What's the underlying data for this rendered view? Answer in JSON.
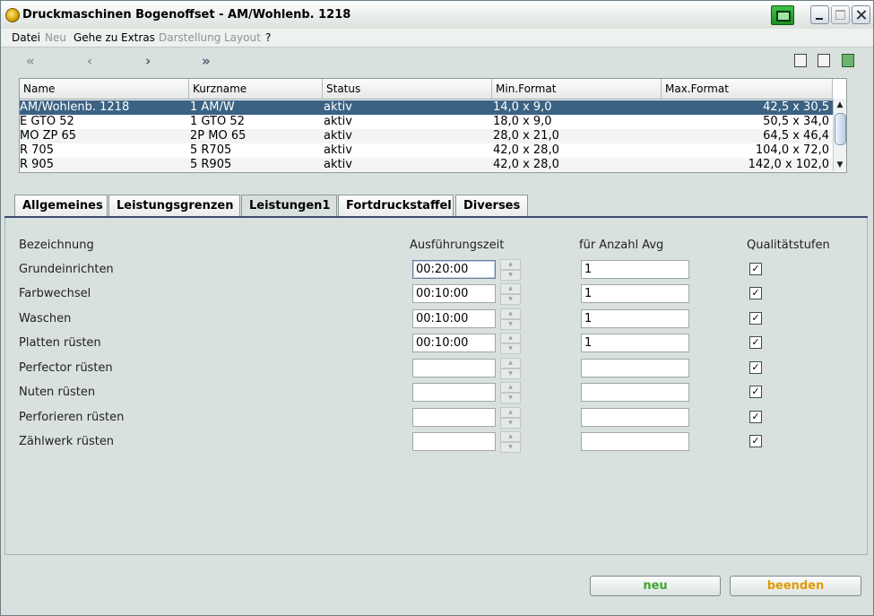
{
  "window": {
    "title": "Druckmaschinen Bogenoffset - AM/Wohlenb.  1218"
  },
  "menu": [
    "Datei",
    "Neu",
    "Gehe zu",
    "Extras",
    "Darstellung",
    "Layout",
    "?"
  ],
  "grid": {
    "columns": [
      "Name",
      "Kurzname",
      "Status",
      "Min.Format",
      "Max.Format"
    ],
    "rows": [
      {
        "name": "AM/Wohlenb.  1218",
        "kurz": "1  AM/W",
        "status": "aktiv",
        "min": "14,0 x 9,0",
        "max": "42,5 x 30,5"
      },
      {
        "name": "E  GTO 52",
        "kurz": "1  GTO  52",
        "status": "aktiv",
        "min": "18,0 x 9,0",
        "max": "50,5 x 34,0"
      },
      {
        "name": "MO ZP 65",
        "kurz": "2P MO   65",
        "status": "aktiv",
        "min": "28,0 x 21,0",
        "max": "64,5 x 46,4"
      },
      {
        "name": "R 705",
        "kurz": "5  R705",
        "status": "aktiv",
        "min": "42,0 x 28,0",
        "max": "104,0 x 72,0"
      },
      {
        "name": "R 905",
        "kurz": "5  R905",
        "status": "aktiv",
        "min": "42,0 x 28,0",
        "max": "142,0 x 102,0"
      }
    ]
  },
  "tabs": [
    "Allgemeines",
    "Leistungsgrenzen",
    "Leistungen1",
    "Fortdruckstaffel",
    "Diverses"
  ],
  "form": {
    "headers": {
      "bez": "Bezeichnung",
      "zeit": "Ausführungszeit",
      "anzahl": "für Anzahl Avg",
      "qual": "Qualitätstufen"
    },
    "rows": [
      {
        "label": "Grundeinrichten",
        "zeit": "00:20:00",
        "anzahl": "1"
      },
      {
        "label": "Farbwechsel",
        "zeit": "00:10:00",
        "anzahl": "1"
      },
      {
        "label": "Waschen",
        "zeit": "00:10:00",
        "anzahl": "1"
      },
      {
        "label": "Platten rüsten",
        "zeit": "00:10:00",
        "anzahl": "1"
      },
      {
        "label": "Perfector rüsten",
        "zeit": "",
        "anzahl": ""
      },
      {
        "label": "Nuten rüsten",
        "zeit": "",
        "anzahl": ""
      },
      {
        "label": "Perforieren rüsten",
        "zeit": "",
        "anzahl": ""
      },
      {
        "label": "Zählwerk rüsten",
        "zeit": "",
        "anzahl": ""
      }
    ],
    "check_glyph": "✓"
  },
  "buttons": {
    "neu": "neu",
    "beenden": "beenden"
  },
  "colors": {
    "neu": "#3fa62b",
    "beenden": "#e19a00",
    "selection": "#3b6283"
  }
}
